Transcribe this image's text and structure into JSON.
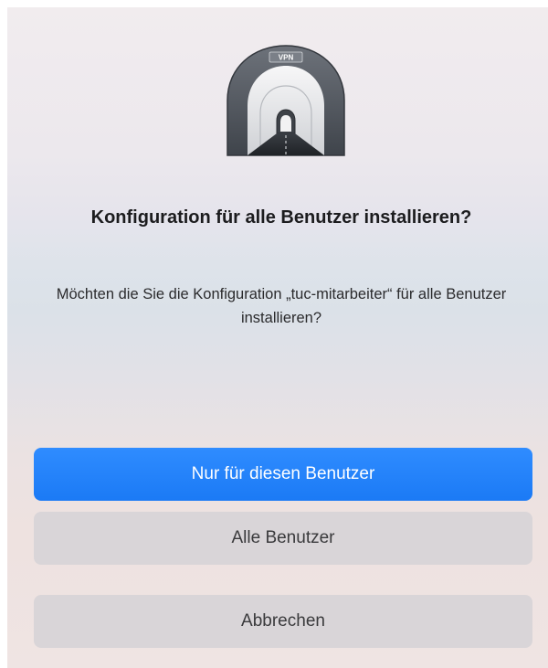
{
  "dialog": {
    "icon": {
      "name": "vpn-tunnel-icon",
      "badge_text": "VPN"
    },
    "title": "Konfiguration für alle Benutzer installieren?",
    "message": "Möchten die Sie die Konfiguration „tuc-mitarbeiter“ für alle Benutzer installieren?",
    "buttons": {
      "primary": "Nur für diesen Benutzer",
      "secondary": "Alle Benutzer",
      "cancel": "Abbrechen"
    },
    "colors": {
      "primary_button": "#1b7af5",
      "secondary_button": "#d9d5d8"
    }
  }
}
